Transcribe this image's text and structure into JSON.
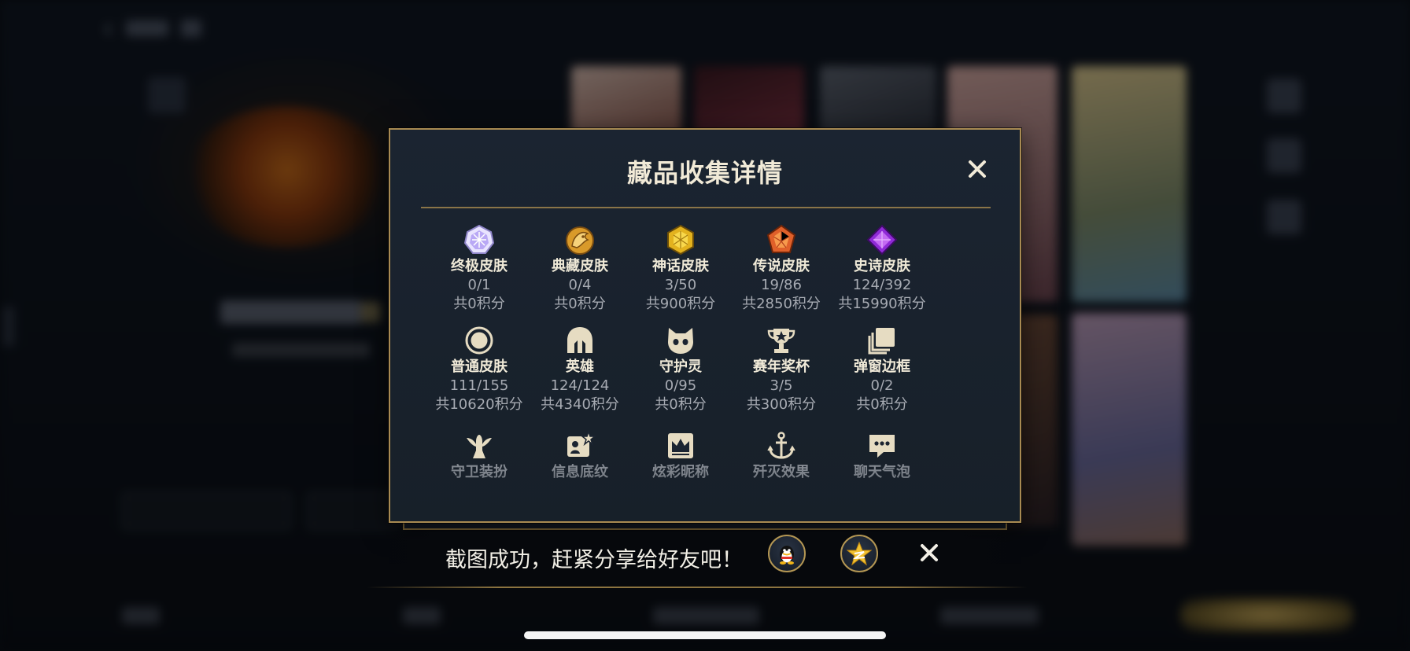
{
  "modal": {
    "title": "藏品收集详情",
    "categories": [
      {
        "name": "终极皮肤",
        "count": "0/1",
        "points": "共0积分",
        "icon": "ultimate-skin-gem-icon"
      },
      {
        "name": "典藏皮肤",
        "count": "0/4",
        "points": "共0积分",
        "icon": "collector-skin-dragon-icon"
      },
      {
        "name": "神话皮肤",
        "count": "3/50",
        "points": "共900积分",
        "icon": "mythic-skin-gem-icon"
      },
      {
        "name": "传说皮肤",
        "count": "19/86",
        "points": "共2850积分",
        "icon": "legendary-skin-gem-icon"
      },
      {
        "name": "史诗皮肤",
        "count": "124/392",
        "points": "共15990积分",
        "icon": "epic-skin-gem-icon"
      },
      {
        "name": "普通皮肤",
        "count": "111/155",
        "points": "共10620积分",
        "icon": "normal-skin-ring-icon"
      },
      {
        "name": "英雄",
        "count": "124/124",
        "points": "共4340积分",
        "icon": "hero-helmet-icon"
      },
      {
        "name": "守护灵",
        "count": "0/95",
        "points": "共0积分",
        "icon": "guardian-spirit-icon"
      },
      {
        "name": "赛年奖杯",
        "count": "3/5",
        "points": "共300积分",
        "icon": "season-trophy-icon"
      },
      {
        "name": "弹窗边框",
        "count": "0/2",
        "points": "共0积分",
        "icon": "popup-frame-icon"
      },
      {
        "name": "守卫装扮",
        "icon": "ward-skin-icon"
      },
      {
        "name": "信息底纹",
        "icon": "profile-card-icon"
      },
      {
        "name": "炫彩昵称",
        "icon": "colorful-nickname-icon"
      },
      {
        "name": "歼灭效果",
        "icon": "kill-effect-icon"
      },
      {
        "name": "聊天气泡",
        "icon": "chat-bubble-icon"
      }
    ]
  },
  "share": {
    "text": "截图成功，赶紧分享给好友吧！",
    "buttons": [
      {
        "icon": "qq-penguin-icon"
      },
      {
        "icon": "qzone-star-icon"
      }
    ]
  },
  "colors": {
    "gold": "#a88a52",
    "modal_bg": "#1b2431",
    "muted_text": "#a7abb3"
  }
}
